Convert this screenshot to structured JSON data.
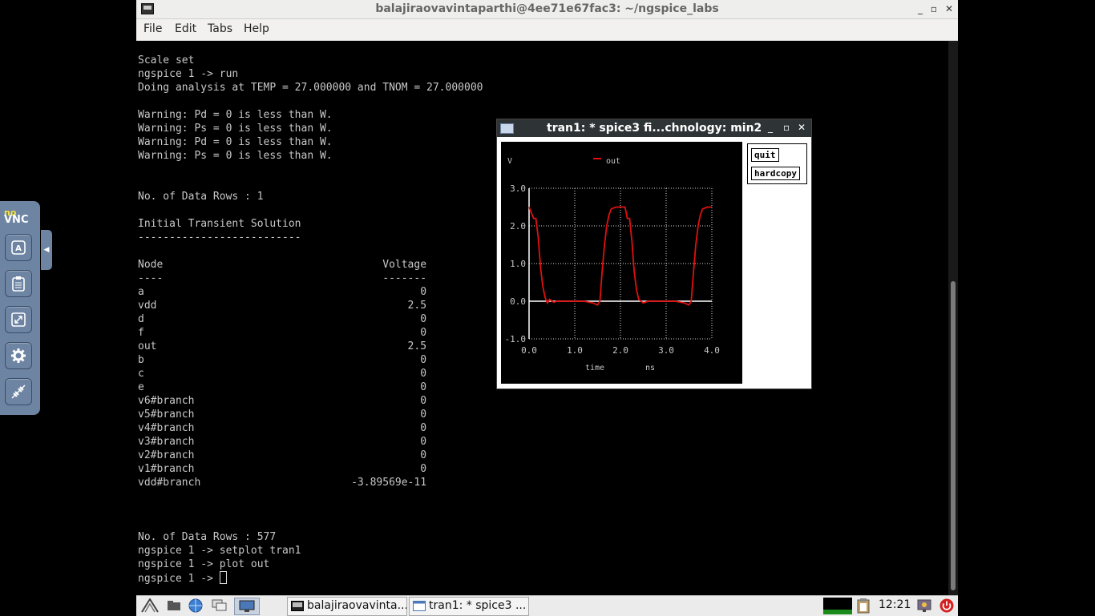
{
  "terminal": {
    "title": "balajiraovavintaparthi@4ee71e67fac3: ~/ngspice_labs",
    "menu": [
      "File",
      "Edit",
      "Tabs",
      "Help"
    ],
    "lines": [
      "Scale set",
      "ngspice 1 -> run",
      "Doing analysis at TEMP = 27.000000 and TNOM = 27.000000",
      "",
      "Warning: Pd = 0 is less than W.",
      "Warning: Ps = 0 is less than W.",
      "Warning: Pd = 0 is less than W.",
      "Warning: Ps = 0 is less than W.",
      "",
      "",
      "No. of Data Rows : 1",
      "",
      "Initial Transient Solution",
      "--------------------------",
      "",
      "Node                                   Voltage",
      "----                                   -------",
      "a                                            0",
      "vdd                                        2.5",
      "d                                            0",
      "f                                            0",
      "out                                        2.5",
      "b                                            0",
      "c                                            0",
      "e                                            0",
      "v6#branch                                    0",
      "v5#branch                                    0",
      "v4#branch                                    0",
      "v3#branch                                    0",
      "v2#branch                                    0",
      "v1#branch                                    0",
      "vdd#branch                        -3.89569e-11",
      "",
      "",
      "",
      "No. of Data Rows : 577",
      "ngspice 1 -> setplot tran1",
      "ngspice 1 -> plot out"
    ],
    "prompt": "ngspice 1 -> "
  },
  "plot_window": {
    "title": "tran1: * spice3 fi...chnology: min2",
    "buttons": {
      "quit": "quit",
      "hardcopy": "hardcopy"
    },
    "text_color": "#c8c8c8",
    "trace_color": "#e01010"
  },
  "chart_data": {
    "type": "line",
    "title": "",
    "ylabel": "V",
    "xlabel": "time",
    "xunit": "ns",
    "xlim": [
      0,
      4.0
    ],
    "ylim": [
      -1.0,
      3.0
    ],
    "xticks": [
      "0.0",
      "1.0",
      "2.0",
      "3.0",
      "4.0"
    ],
    "yticks": [
      "-1.0",
      "0.0",
      "1.0",
      "2.0",
      "3.0"
    ],
    "grid": true,
    "legend": "top",
    "series": [
      {
        "name": "out",
        "x": [
          0.0,
          0.1,
          0.15,
          0.2,
          0.25,
          0.3,
          0.35,
          0.4,
          0.45,
          0.5,
          0.55,
          0.6,
          0.7,
          0.8,
          1.0,
          1.2,
          1.4,
          1.5,
          1.55,
          1.6,
          1.65,
          1.7,
          1.75,
          1.8,
          1.9,
          2.0,
          2.1,
          2.15,
          2.2,
          2.25,
          2.3,
          2.35,
          2.4,
          2.45,
          2.5,
          2.6,
          2.7,
          3.0,
          3.2,
          3.4,
          3.5,
          3.55,
          3.6,
          3.65,
          3.7,
          3.75,
          3.8,
          3.9,
          4.0
        ],
        "y": [
          2.5,
          2.2,
          2.2,
          1.7,
          0.9,
          0.4,
          0.1,
          -0.05,
          0.05,
          0.0,
          -0.03,
          0.0,
          0.0,
          0.0,
          0.0,
          0.0,
          -0.05,
          -0.1,
          0.0,
          0.8,
          1.5,
          2.0,
          2.3,
          2.45,
          2.5,
          2.5,
          2.5,
          2.2,
          2.2,
          1.6,
          0.8,
          0.3,
          0.05,
          0.0,
          -0.05,
          0.0,
          0.0,
          0.0,
          0.0,
          -0.05,
          -0.1,
          0.0,
          0.8,
          1.5,
          2.0,
          2.3,
          2.45,
          2.5,
          2.5
        ]
      }
    ]
  },
  "taskbar": {
    "tasks": [
      "balajiraovavinta...",
      "tran1: * spice3 ..."
    ],
    "clock": "12:21"
  },
  "novnc": {
    "logo_top": "no",
    "logo_bottom": "VNC"
  }
}
